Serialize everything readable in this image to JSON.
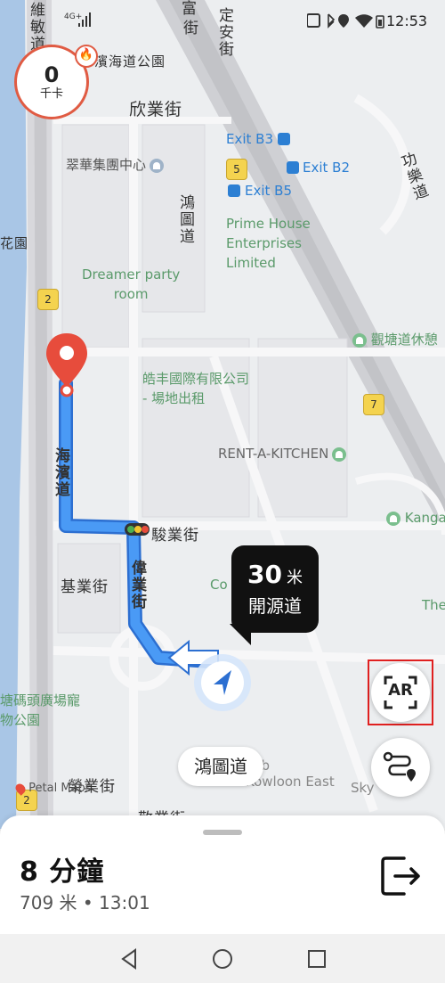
{
  "status_bar": {
    "time": "12:53",
    "network": "4G+",
    "icons": [
      "nfc-icon",
      "bluetooth-icon",
      "location-icon",
      "wifi-icon",
      "battery-icon"
    ]
  },
  "calorie": {
    "value": "0",
    "unit": "千卡"
  },
  "map": {
    "streets": [
      {
        "id": "haibin-top",
        "text": "濱海道公園"
      },
      {
        "id": "yanye",
        "text": "欣業街"
      },
      {
        "id": "fu",
        "text": "富"
      },
      {
        "id": "fu2",
        "text": "街"
      },
      {
        "id": "dingan",
        "text": "定安街"
      },
      {
        "id": "honghong",
        "text": "鴻圖道"
      },
      {
        "id": "gongle",
        "text": "功樂道"
      },
      {
        "id": "haibin",
        "text": "海濱道"
      },
      {
        "id": "junye",
        "text": "駿業街"
      },
      {
        "id": "weiye",
        "text": "偉業街"
      },
      {
        "id": "jiye",
        "text": "基業街"
      },
      {
        "id": "rongye",
        "text": "榮業街"
      },
      {
        "id": "jingye",
        "text": "敬業街"
      },
      {
        "id": "chaoye",
        "text": "維敏道"
      },
      {
        "id": "huayuan",
        "text": "花園"
      }
    ],
    "pois": {
      "cuihua": "翠華集團中心",
      "prime": "Prime House\nEnterprises\nLimited",
      "dreamer": "Dreamer party\nroom",
      "haofeng": "皓丰國際有限公司\n- 場地出租",
      "rent": "RENT-A-KITCHEN",
      "guantang": "觀塘道休憩",
      "kanga": "Kanga",
      "co": "Co",
      "the": "The",
      "tangmatou": "塘碼頭廣場寵\n物公園",
      "lab": "llab\nKowloon East",
      "sky": "Sky"
    },
    "exits": {
      "b3": "Exit B3",
      "b2": "Exit B2",
      "b5": "Exit B5"
    },
    "shields": {
      "s5": "5",
      "s2": "2",
      "s7": "7",
      "s2b": "2"
    },
    "watermark": "Petal Maps"
  },
  "instruction": {
    "distance": "30",
    "unit": "米",
    "street": "開源道"
  },
  "current_street": "鴻圖道",
  "ar_button": "AR",
  "summary": {
    "duration": "8 分鐘",
    "distance": "709 米",
    "separator": "•",
    "arrival": "13:01"
  },
  "colors": {
    "route": "#3a8ef0",
    "route_border": "#2c6fd1",
    "destination": "#e74c3c",
    "calorie_ring": "#e05b43",
    "highlight_box": "#e02020"
  }
}
